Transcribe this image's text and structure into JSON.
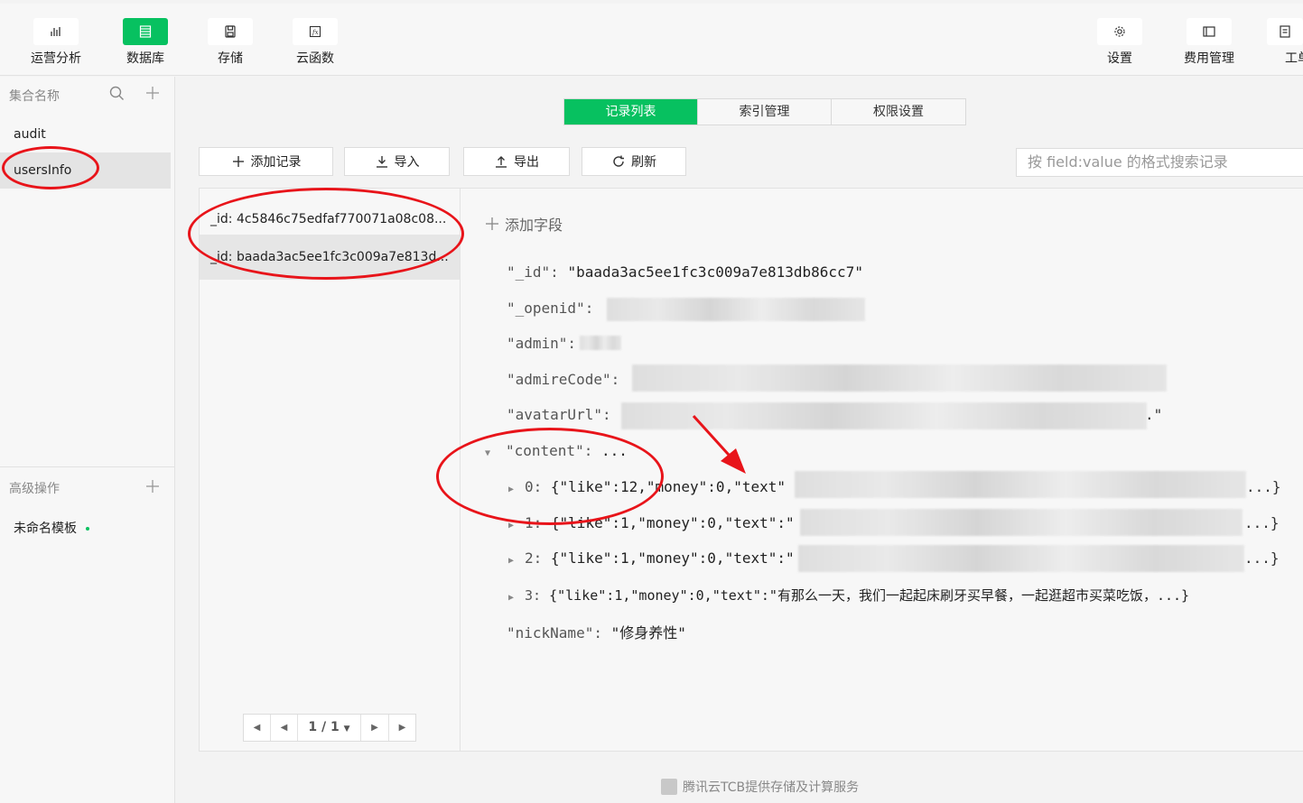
{
  "toolbar": {
    "left": [
      {
        "label": "运营分析",
        "icon": "bar-chart-icon"
      },
      {
        "label": "数据库",
        "icon": "database-icon",
        "active": true
      },
      {
        "label": "存储",
        "icon": "floppy-icon"
      },
      {
        "label": "云函数",
        "icon": "function-icon"
      }
    ],
    "right": [
      {
        "label": "设置",
        "icon": "gear-icon"
      },
      {
        "label": "费用管理",
        "icon": "billing-icon"
      },
      {
        "label": "工单",
        "icon": "ticket-icon"
      }
    ]
  },
  "sidebar": {
    "collections_header": "集合名称",
    "collections": [
      "audit",
      "usersInfo"
    ],
    "selected_collection": "usersInfo",
    "advanced_header": "高级操作",
    "template_item": "未命名模板"
  },
  "tabs": [
    "记录列表",
    "索引管理",
    "权限设置"
  ],
  "active_tab": "记录列表",
  "actions": {
    "add": "添加记录",
    "import": "导入",
    "export": "导出",
    "refresh": "刷新"
  },
  "search": {
    "placeholder": "按 field:value 的格式搜索记录"
  },
  "records": [
    "_id: 4c5846c75edfaf770071a08c08...",
    "_id: baada3ac5ee1fc3c009a7e813d..."
  ],
  "pager": {
    "label": "1 / 1"
  },
  "document": {
    "add_field": "添加字段",
    "id_key": "\"_id\":",
    "id_value": "\"baada3ac5ee1fc3c009a7e813db86cc7\"",
    "openid_key": "\"_openid\":",
    "admin_key": "\"admin\":",
    "admirecode_key": "\"admireCode\":",
    "avatarurl_key": "\"avatarUrl\":",
    "avatarurl_tail": ".\"",
    "content_key": "\"content\":",
    "content_collapsed": "...",
    "content_items": [
      {
        "index": "0:",
        "head": "{\"like\":12,\"money\":0,\"text\"",
        "tail": "...}"
      },
      {
        "index": "1:",
        "head": "{\"like\":1,\"money\":0,\"text\":\"",
        "tail": "...}"
      },
      {
        "index": "2:",
        "head": "{\"like\":1,\"money\":0,\"text\":\"",
        "tail": "...}"
      },
      {
        "index": "3:",
        "head": "{\"like\":1,\"money\":0,\"text\":\"有那么一天，我们一起起床刷牙买早餐，一起逛超市买菜吃饭，",
        "tail": "...}"
      }
    ],
    "nickname_key": "\"nickName\":",
    "nickname_value": "\"修身养性\""
  },
  "footer": "腾讯云TCB提供存储及计算服务",
  "colors": {
    "accent": "#07c160",
    "annotation": "#e8141a"
  }
}
